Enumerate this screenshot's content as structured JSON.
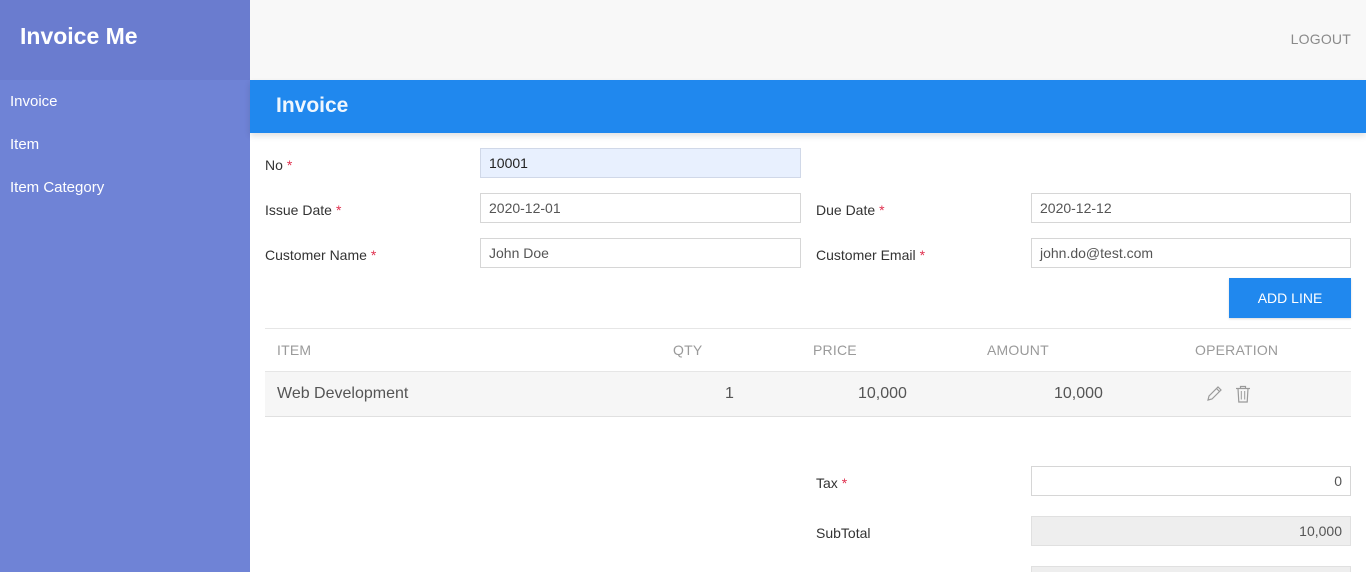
{
  "app": {
    "brand": "Invoice Me"
  },
  "sidebar": {
    "items": [
      {
        "label": "Invoice"
      },
      {
        "label": "Item"
      },
      {
        "label": "Item Category"
      }
    ]
  },
  "topbar": {
    "logout_label": "LOGOUT"
  },
  "page": {
    "title": "Invoice"
  },
  "form": {
    "no": {
      "label": "No",
      "value": "10001"
    },
    "issue_date": {
      "label": "Issue Date",
      "value": "2020-12-01"
    },
    "due_date": {
      "label": "Due Date",
      "value": "2020-12-12"
    },
    "customer_name": {
      "label": "Customer Name",
      "value": "John Doe"
    },
    "customer_email": {
      "label": "Customer Email",
      "value": "john.do@test.com"
    },
    "required_mark": "*"
  },
  "actions": {
    "add_line_label": "ADD LINE"
  },
  "table": {
    "headers": {
      "item": "ITEM",
      "qty": "QTY",
      "price": "PRICE",
      "amount": "AMOUNT",
      "operation": "OPERATION"
    },
    "rows": [
      {
        "item": "Web Development",
        "qty": "1",
        "price": "10,000",
        "amount": "10,000"
      }
    ]
  },
  "totals": {
    "tax": {
      "label": "Tax",
      "value": "0"
    },
    "subtotal": {
      "label": "SubTotal",
      "value": "10,000"
    }
  },
  "icons": {
    "edit": "pencil-icon",
    "delete": "trash-icon"
  },
  "colors": {
    "sidebar": "#6f83d6",
    "brand_bar": "#6a7ccf",
    "accent": "#2088ee",
    "required": "#e0314f"
  }
}
